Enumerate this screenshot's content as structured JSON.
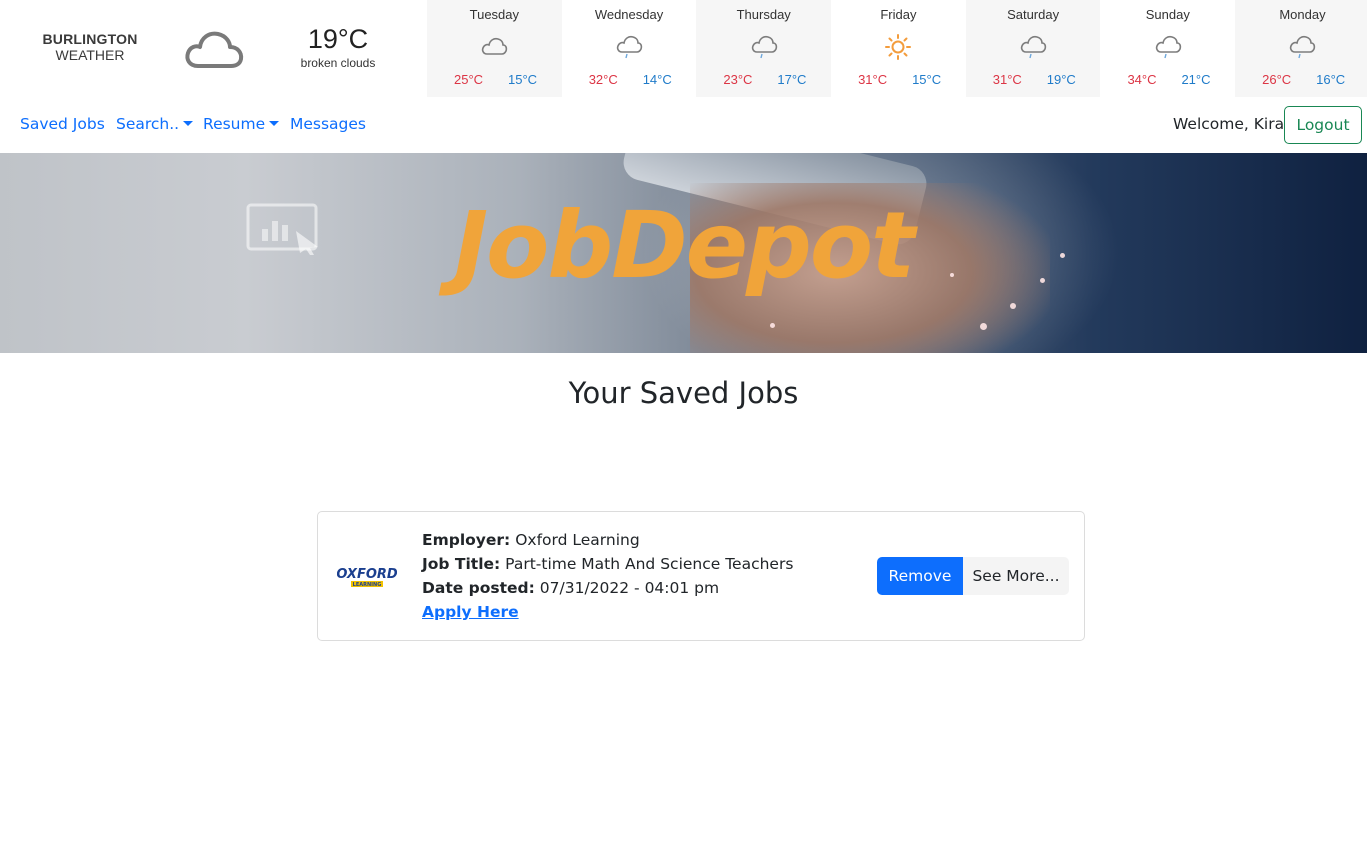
{
  "weather": {
    "city": "BURLINGTON",
    "label": "WEATHER",
    "current_temp": "19°C",
    "current_desc": "broken clouds",
    "current_icon": "cloud-icon",
    "forecast": [
      {
        "day": "Tuesday",
        "icon": "cloud-icon",
        "high": "25°C",
        "low": "15°C"
      },
      {
        "day": "Wednesday",
        "icon": "rain-cloud-icon",
        "high": "32°C",
        "low": "14°C"
      },
      {
        "day": "Thursday",
        "icon": "rain-cloud-icon",
        "high": "23°C",
        "low": "17°C"
      },
      {
        "day": "Friday",
        "icon": "sun-icon",
        "high": "31°C",
        "low": "15°C"
      },
      {
        "day": "Saturday",
        "icon": "rain-cloud-icon",
        "high": "31°C",
        "low": "19°C"
      },
      {
        "day": "Sunday",
        "icon": "rain-cloud-icon",
        "high": "34°C",
        "low": "21°C"
      },
      {
        "day": "Monday",
        "icon": "rain-cloud-icon",
        "high": "26°C",
        "low": "16°C"
      }
    ]
  },
  "nav": {
    "saved_jobs": "Saved Jobs",
    "search": "Search..",
    "resume": "Resume",
    "messages": "Messages",
    "welcome": "Welcome, Kira",
    "logout": "Logout"
  },
  "banner": {
    "title": "JobDepot"
  },
  "main": {
    "title": "Your Saved Jobs",
    "jobs": [
      {
        "employer_label": "Employer:",
        "employer": "Oxford Learning",
        "title_label": "Job Title:",
        "title": "Part-time Math And Science Teachers",
        "date_label": "Date posted:",
        "date": "07/31/2022 - 04:01 pm",
        "apply": "Apply Here",
        "remove": "Remove",
        "see_more": "See More...",
        "logo_text": "OXFORD",
        "logo_subtext": "LEARNING"
      }
    ]
  },
  "colors": {
    "primary": "#0d6efd",
    "success": "#198754",
    "brand_orange": "#f0a43a",
    "temp_high": "#dc3545",
    "temp_low": "#1f7bc9"
  }
}
